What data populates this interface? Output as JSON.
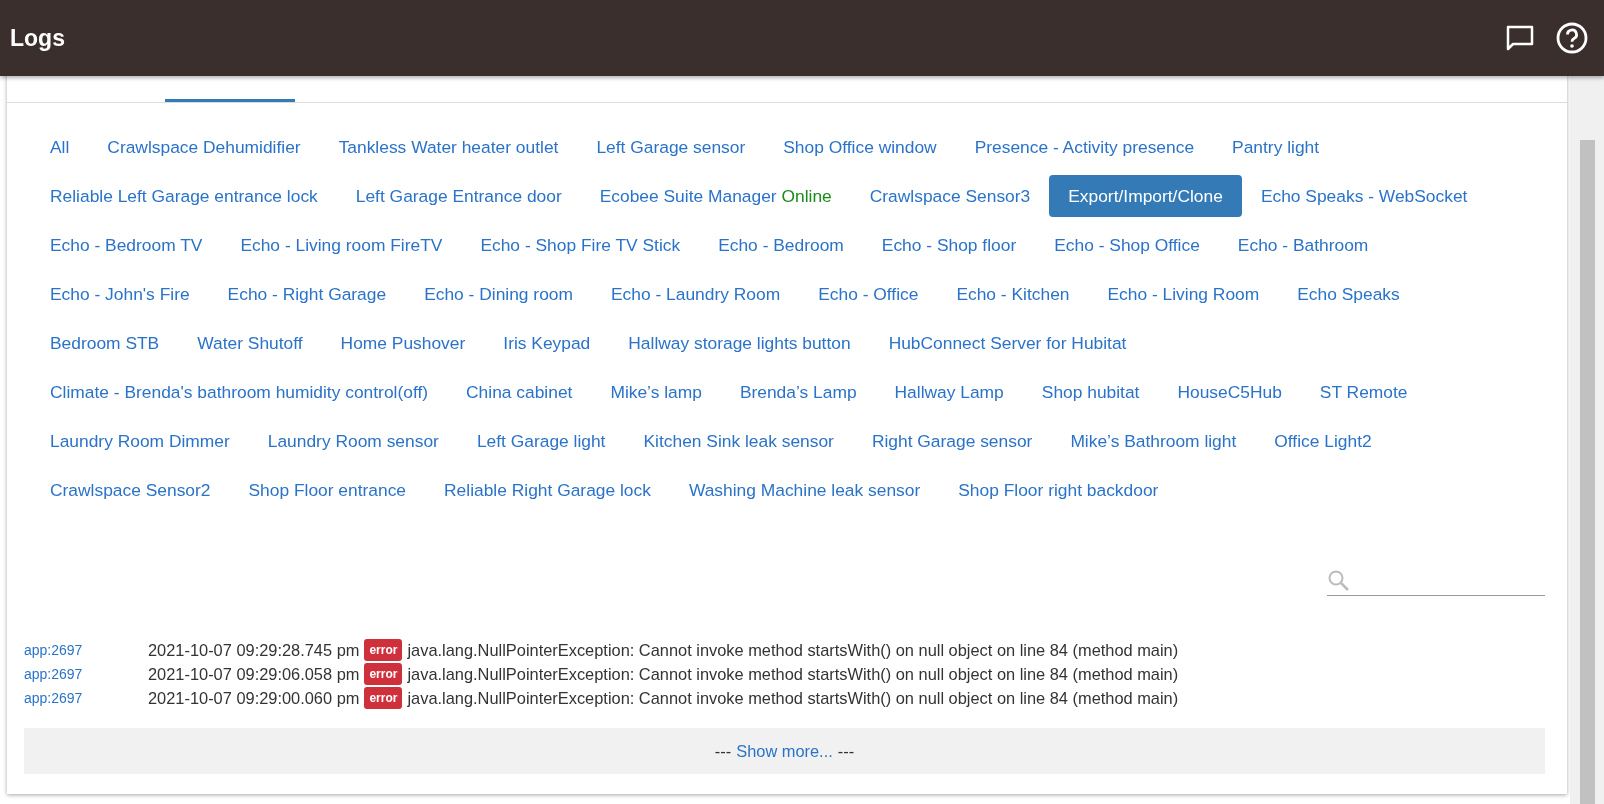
{
  "header": {
    "title": "Logs"
  },
  "tabs": [
    {
      "selected": false
    },
    {
      "selected": true
    },
    {
      "selected": false
    },
    {
      "selected": false
    },
    {
      "selected": false
    },
    {
      "selected": false
    },
    {
      "selected": false
    }
  ],
  "filters": [
    {
      "label": "All",
      "selected": false
    },
    {
      "label": "Crawlspace Dehumidifier",
      "selected": false
    },
    {
      "label": "Tankless Water heater outlet",
      "selected": false
    },
    {
      "label": "Left Garage sensor",
      "selected": false
    },
    {
      "label": "Shop Office window",
      "selected": false
    },
    {
      "label": "Presence - Activity presence",
      "selected": false
    },
    {
      "label": "Pantry light",
      "selected": false
    },
    {
      "label": "Reliable Left Garage entrance lock",
      "selected": false
    },
    {
      "label": "Left Garage Entrance door",
      "selected": false
    },
    {
      "label": "Ecobee Suite Manager",
      "status": "Online",
      "selected": false
    },
    {
      "label": "Crawlspace Sensor3",
      "selected": false
    },
    {
      "label": "Export/Import/Clone",
      "selected": true
    },
    {
      "label": "Echo Speaks - WebSocket",
      "selected": false
    },
    {
      "label": "Echo - Bedroom TV",
      "selected": false
    },
    {
      "label": "Echo - Living room FireTV",
      "selected": false
    },
    {
      "label": "Echo - Shop Fire TV Stick",
      "selected": false
    },
    {
      "label": "Echo - Bedroom",
      "selected": false
    },
    {
      "label": "Echo - Shop floor",
      "selected": false
    },
    {
      "label": "Echo - Shop Office",
      "selected": false
    },
    {
      "label": "Echo - Bathroom",
      "selected": false
    },
    {
      "label": "Echo - John's Fire",
      "selected": false
    },
    {
      "label": "Echo - Right Garage",
      "selected": false
    },
    {
      "label": "Echo - Dining room",
      "selected": false
    },
    {
      "label": "Echo - Laundry Room",
      "selected": false
    },
    {
      "label": "Echo - Office",
      "selected": false
    },
    {
      "label": "Echo - Kitchen",
      "selected": false
    },
    {
      "label": "Echo - Living Room",
      "selected": false
    },
    {
      "label": "Echo Speaks",
      "selected": false
    },
    {
      "label": "Bedroom STB",
      "selected": false
    },
    {
      "label": "Water Shutoff",
      "selected": false
    },
    {
      "label": "Home Pushover",
      "selected": false
    },
    {
      "label": "Iris Keypad",
      "selected": false
    },
    {
      "label": "Hallway storage lights button",
      "selected": false
    },
    {
      "label": "HubConnect Server for Hubitat",
      "selected": false
    },
    {
      "label": "Climate - Brenda's bathroom humidity control(off)",
      "selected": false
    },
    {
      "label": "China cabinet",
      "selected": false
    },
    {
      "label": "Mike’s lamp",
      "selected": false
    },
    {
      "label": "Brenda’s Lamp",
      "selected": false
    },
    {
      "label": "Hallway Lamp",
      "selected": false
    },
    {
      "label": "Shop hubitat",
      "selected": false
    },
    {
      "label": "HouseC5Hub",
      "selected": false
    },
    {
      "label": "ST Remote",
      "selected": false
    },
    {
      "label": "Laundry Room Dimmer",
      "selected": false
    },
    {
      "label": "Laundry Room sensor",
      "selected": false
    },
    {
      "label": "Left Garage light",
      "selected": false
    },
    {
      "label": "Kitchen Sink leak sensor",
      "selected": false
    },
    {
      "label": "Right Garage sensor",
      "selected": false
    },
    {
      "label": "Mike’s Bathroom light",
      "selected": false
    },
    {
      "label": "Office Light2",
      "selected": false
    },
    {
      "label": "Crawlspace Sensor2",
      "selected": false
    },
    {
      "label": "Shop Floor entrance",
      "selected": false
    },
    {
      "label": "Reliable Right Garage lock",
      "selected": false
    },
    {
      "label": "Washing Machine leak sensor",
      "selected": false
    },
    {
      "label": "Shop Floor right backdoor",
      "selected": false
    }
  ],
  "logs": [
    {
      "source": "app:2697",
      "time": "2021-10-07 09:29:28.745 pm",
      "level": "error",
      "message": "java.lang.NullPointerException: Cannot invoke method startsWith() on null object on line 84 (method main)"
    },
    {
      "source": "app:2697",
      "time": "2021-10-07 09:29:06.058 pm",
      "level": "error",
      "message": "java.lang.NullPointerException: Cannot invoke method startsWith() on null object on line 84 (method main)"
    },
    {
      "source": "app:2697",
      "time": "2021-10-07 09:29:00.060 pm",
      "level": "error",
      "message": "java.lang.NullPointerException: Cannot invoke method startsWith() on null object on line 84 (method main)"
    }
  ],
  "show_more": {
    "prefix": "---",
    "link": "Show more...",
    "suffix": "---"
  }
}
